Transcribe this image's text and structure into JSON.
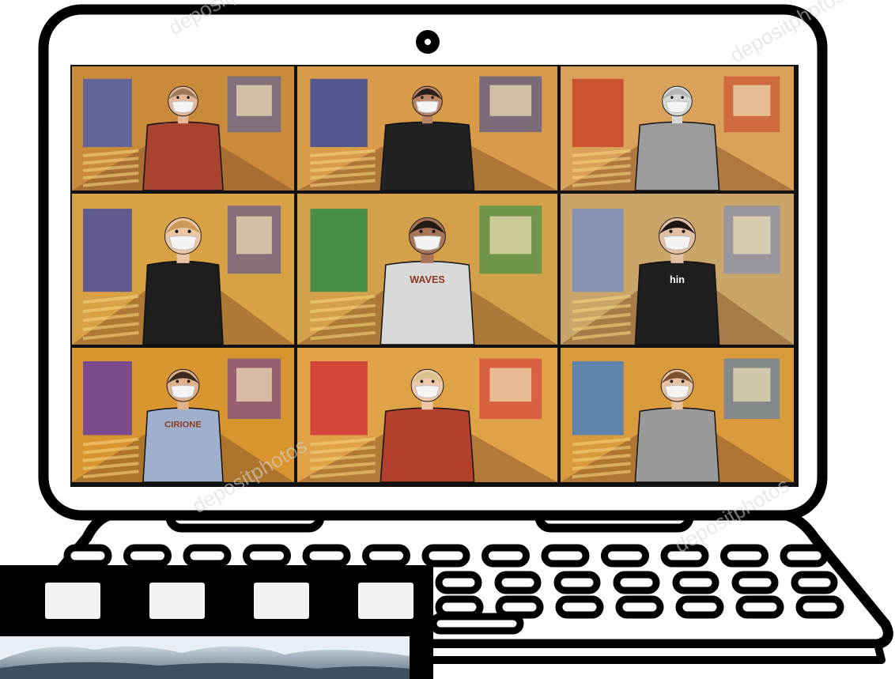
{
  "colors": {
    "outline": "#000000",
    "bezel": "#ffffff",
    "screen_bg": "#1a1a2e",
    "watermark": "#d7d7d7"
  },
  "icons": [
    "webcam-icon"
  ],
  "video_grid": {
    "tiles": [
      {
        "participant": "boy-cap-plaid-shirt",
        "wall": "#c98a3a",
        "accent": "#4f5fa8",
        "shirt": "#a8432f",
        "skin": "#e6b796",
        "hair": "#9a7a58"
      },
      {
        "participant": "boy-black-hoodie",
        "wall": "#d89b4a",
        "accent": "#3d4b9a",
        "shirt": "#222222",
        "skin": "#b98464",
        "hair": "#2a1f1a"
      },
      {
        "participant": "person-astronaut-suit",
        "wall": "#d9a15a",
        "accent": "#c8452c",
        "shirt": "#9b9b9b",
        "skin": "#d6d6d6",
        "hair": "#b5b5b5"
      },
      {
        "participant": "boy-glasses-black-jacket",
        "wall": "#d7a144",
        "accent": "#4b4f9c",
        "shirt": "#1e1e1e",
        "skin": "#ecc3a3",
        "hair": "#c79a5a"
      },
      {
        "participant": "boy-white-tshirt",
        "wall": "#d3a04a",
        "accent": "#2f8c4a",
        "shirt": "#d8d8d8",
        "skin": "#a87457",
        "hair": "#231a14",
        "shirt_text": "WAVES"
      },
      {
        "participant": "girl-cat-ears",
        "wall": "#c9a56a",
        "accent": "#7a8cc0",
        "shirt": "#1f1f1f",
        "skin": "#e4bea1",
        "hair": "#1c1612",
        "shirt_text": "hin"
      },
      {
        "participant": "boy-blue-sweatshirt",
        "wall": "#d8952f",
        "accent": "#6a3d9a",
        "shirt": "#9fb0cf",
        "skin": "#e1b08a",
        "hair": "#3b2a1f",
        "shirt_text": "CIRIONE"
      },
      {
        "participant": "girl-blonde-crown",
        "wall": "#e0a246",
        "accent": "#d0343a",
        "shirt": "#b3402c",
        "skin": "#f0c7a8",
        "hair": "#d8c48a"
      },
      {
        "participant": "child-crown-grey-coat",
        "wall": "#d99a3c",
        "accent": "#4a7fc0",
        "shirt": "#9a9a9a",
        "skin": "#e7c09f",
        "hair": "#7b5230"
      }
    ]
  },
  "film_strip": {
    "holes": 4
  },
  "watermark": {
    "text": "depositphotos"
  }
}
